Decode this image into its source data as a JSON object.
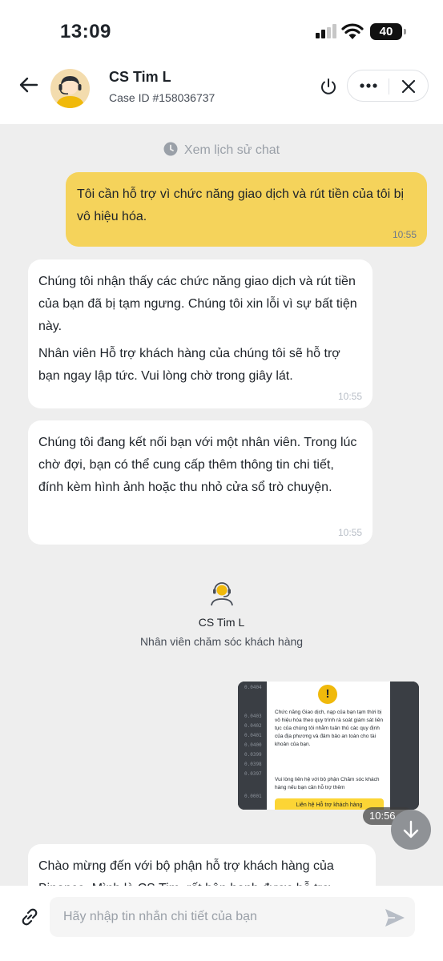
{
  "status_bar": {
    "time": "13:09",
    "battery": "40"
  },
  "header": {
    "agent_name": "CS Tim L",
    "case_id": "Case ID #158036737",
    "icons": [
      "back-arrow-icon",
      "power-icon",
      "more-icon",
      "close-icon"
    ]
  },
  "chat": {
    "history_link": "Xem lịch sử chat",
    "messages": [
      {
        "from": "user",
        "text": "Tôi cần hỗ trợ vì chức năng giao dịch và rút tiền của tôi bị vô hiệu hóa.",
        "time": "10:55"
      },
      {
        "from": "agent",
        "paragraphs": [
          "Chúng tôi nhận thấy các chức năng giao dịch và rút tiền của bạn đã bị tạm ngưng. Chúng tôi xin lỗi vì sự bất tiện này.",
          "Nhân viên Hỗ trợ khách hàng của chúng tôi sẽ hỗ trợ bạn ngay lập tức. Vui lòng chờ trong giây lát."
        ],
        "time": "10:55"
      },
      {
        "from": "agent",
        "paragraphs": [
          "Chúng tôi đang kết nối bạn với một nhân viên. Trong lúc chờ đợi, bạn có thể cung cấp thêm thông tin chi tiết, đính kèm hình ảnh hoặc thu nhỏ cửa sổ trò chuyện."
        ],
        "time": "10:55"
      },
      {
        "from": "agent",
        "paragraphs": [
          "Chào mừng đến với bộ phận hỗ trợ khách hàng của Binance. Mình là CS Tim, rất hân hạnh được hỗ trợ"
        ]
      }
    ],
    "agent_card": {
      "name": "CS Tim L",
      "role": "Nhân viên chăm sóc khách hàng"
    },
    "attachment": {
      "time": "10:56 ✓",
      "modal_text": "Chức năng Giao dịch, nạp của bạn tạm thời bị vô hiệu hóa theo quy trình rà soát giám sát liên tục của chúng tôi nhằm tuân thủ các quy định của địa phương và đảm bảo an toàn cho tài khoản của bạn.",
      "modal_text2": "Vui lòng liên hệ với bộ phận Chăm sóc khách hàng nếu bạn cần hỗ trợ thêm",
      "modal_button": "Liên hệ Hỗ trợ khách hàng",
      "side_numbers": [
        "0.0404",
        "0.0403",
        "0.0402",
        "0.0401",
        "0.0400",
        "0.0399",
        "0.0398",
        "0.0397",
        "0.0001"
      ]
    }
  },
  "input": {
    "placeholder": "Hãy nhập tin nhắn chi tiết của bạn"
  },
  "colors": {
    "user_bubble": "#f5d35b",
    "chat_bg": "#eeeeee",
    "accent": "#fcd535"
  }
}
